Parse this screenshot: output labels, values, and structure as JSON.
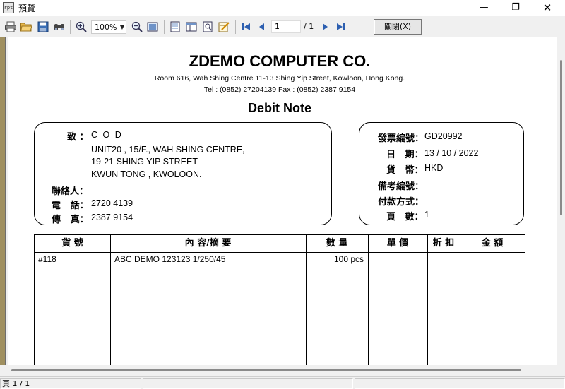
{
  "window": {
    "title": "預覽",
    "app_icon_label": "rpt",
    "minimize_glyph": "—",
    "maximize_glyph": "❐",
    "close_glyph": "✕"
  },
  "toolbar": {
    "icons": [
      "print-icon",
      "open-icon",
      "save-icon",
      "find-icon",
      "zoom-in-icon",
      "zoom-out-icon",
      "whole-page-icon",
      "page-setup-icon",
      "layout-icon",
      "export-icon",
      "edit-icon",
      "first-page-icon",
      "prev-page-icon",
      "next-page-icon",
      "last-page-icon"
    ],
    "zoom_value": "100%",
    "page_number": "1",
    "page_total": "/ 1",
    "close_label": "關閉(X)"
  },
  "report": {
    "company": "ZDEMO COMPUTER CO.",
    "address": "Room 616, Wah Shing Centre 11-13 Shing Yip Street, Kowloon, Hong Kong.",
    "contact": "Tel : (0852) 27204139     Fax : (0852) 2387 9154",
    "doc_title": "Debit Note",
    "customer": {
      "to_label": "致 ：",
      "to_value": "C O D",
      "address_lines": [
        "UNIT20 , 15/F., WAH SHING CENTRE,",
        "19-21 SHING YIP STREET",
        "KWUN TONG , KWOLOON."
      ],
      "contact_label": "聯絡人：",
      "contact_value": "",
      "phone_label": "電   話：",
      "phone_value": "2720 4139",
      "fax_label": "傳   真：",
      "fax_value": "2387 9154"
    },
    "invoice": {
      "number_label": "發票編號：",
      "number_value": "GD20992",
      "date_label": "日   期：",
      "date_value": "13 / 10 / 2022",
      "currency_label": "貨   幣：",
      "currency_value": "HKD",
      "remark_label": "備考編號：",
      "remark_value": "",
      "payment_label": "付款方式：",
      "payment_value": "",
      "pages_label": "頁   數：",
      "pages_value": "1"
    },
    "table": {
      "headers": [
        "貨 號",
        "內 容/摘 要",
        "數 量",
        "單 價",
        "折 扣",
        "金 額"
      ],
      "rows": [
        {
          "item_no": "#118",
          "description": "ABC DEMO 123123 1/250/45",
          "quantity": "100 pcs",
          "unit_price": "",
          "discount": "",
          "amount": ""
        }
      ]
    }
  },
  "status": {
    "page_info": "頁 1 / 1",
    "panel2": "",
    "panel3": ""
  }
}
